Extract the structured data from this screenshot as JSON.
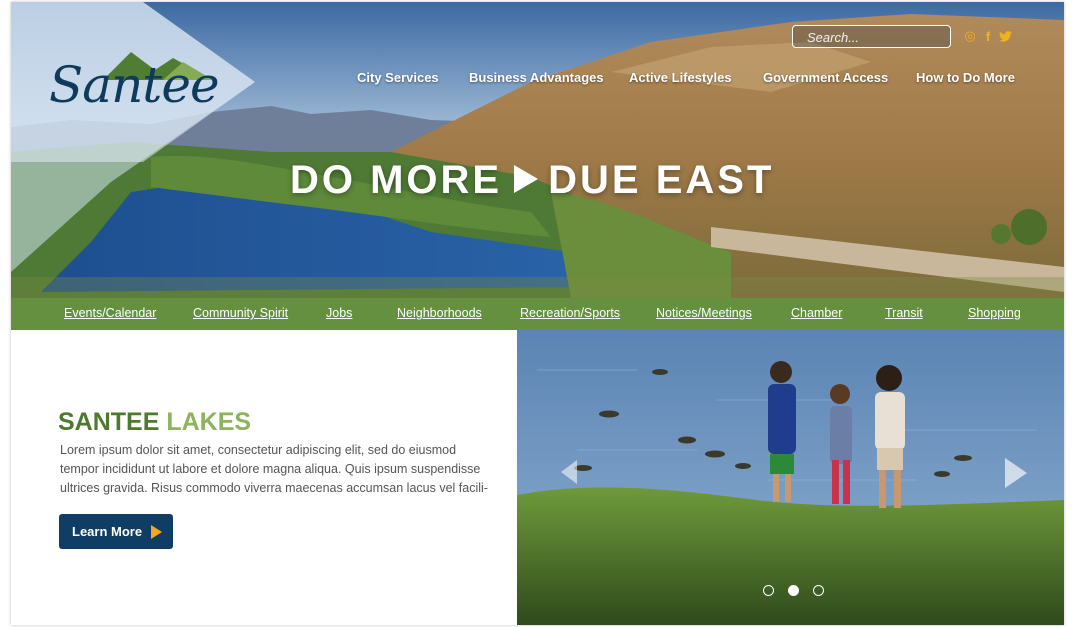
{
  "search": {
    "placeholder": "Search..."
  },
  "social": [
    {
      "icon": "instagram-icon",
      "glyph": "◎"
    },
    {
      "icon": "facebook-icon",
      "glyph": "f"
    },
    {
      "icon": "twitter-icon",
      "glyph": "🐦"
    }
  ],
  "logo": {
    "text": "Santee"
  },
  "topnav": [
    "City Services",
    "Business Advantages",
    "Active Lifestyles",
    "Government Access",
    "How to Do More"
  ],
  "tagline": {
    "left": "DO MORE",
    "right": "DUE EAST"
  },
  "subnav": [
    "Events/Calendar",
    "Community Spirit",
    "Jobs",
    "Neighborhoods",
    "Recreation/Sports",
    "Notices/Meetings",
    "Chamber",
    "Transit",
    "Shopping"
  ],
  "feature": {
    "title_word1": "SANTEE",
    "title_word2": "LAKES",
    "body": "Lorem ipsum dolor sit amet, consectetur adipiscing elit, sed do  eiusmod tempor incididunt ut labore et dolore magna aliqua. Quis ipsum suspendisse ultrices gravida. Risus commodo viverra maecenas accumsan lacus vel facili-",
    "button_label": "Learn More"
  },
  "carousel": {
    "dots": 3,
    "active_index": 1
  },
  "colors": {
    "nav_green": "#659040",
    "navy": "#103d63",
    "accent": "#f2a91c",
    "title_dark_green": "#4d7a30",
    "title_light_green": "#8db35c"
  }
}
